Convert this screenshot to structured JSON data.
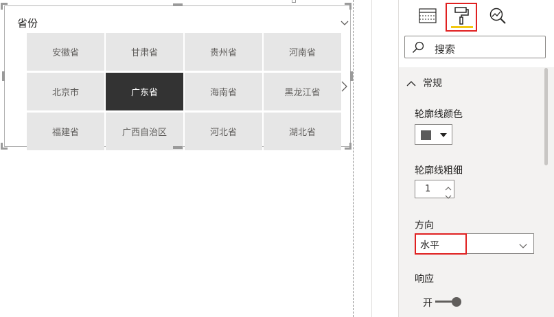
{
  "slicer": {
    "title": "省份",
    "tiles": [
      {
        "label": "安徽省",
        "selected": false
      },
      {
        "label": "甘肃省",
        "selected": false
      },
      {
        "label": "贵州省",
        "selected": false
      },
      {
        "label": "河南省",
        "selected": false
      },
      {
        "label": "北京市",
        "selected": false
      },
      {
        "label": "广东省",
        "selected": true
      },
      {
        "label": "海南省",
        "selected": false
      },
      {
        "label": "黑龙江省",
        "selected": false
      },
      {
        "label": "福建省",
        "selected": false
      },
      {
        "label": "广西自治区",
        "selected": false
      },
      {
        "label": "河北省",
        "selected": false
      },
      {
        "label": "湖北省",
        "selected": false
      }
    ]
  },
  "pane": {
    "tabs": [
      {
        "icon": "fields-grid-icon",
        "active": false
      },
      {
        "icon": "paint-roller-icon",
        "active": true
      },
      {
        "icon": "analytics-magnifier-icon",
        "active": false
      }
    ],
    "search": {
      "placeholder": "搜索"
    },
    "section": {
      "title": "常规",
      "expanded": true
    },
    "outline_color": {
      "label": "轮廓线颜色",
      "value": "#5a5a5a"
    },
    "outline_weight": {
      "label": "轮廓线粗细",
      "value": "1"
    },
    "orientation": {
      "label": "方向",
      "value": "水平"
    },
    "responsive": {
      "label": "响应",
      "state_label": "开",
      "on": true
    }
  },
  "colors": {
    "tile_bg": "#e6e6e6",
    "tile_selected_bg": "#333333",
    "highlight_red": "#e02020",
    "accent_yellow": "#f2c811"
  }
}
